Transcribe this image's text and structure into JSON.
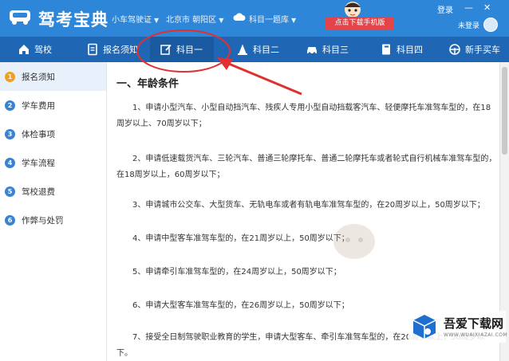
{
  "header": {
    "brand": "驾考宝典",
    "car_type": "小车驾驶证",
    "region": "北京市 朝阳区",
    "exam_select": "科目一题库",
    "promo": "点击下载手机版",
    "login": "登录",
    "user_name": "未登录",
    "win_min": "—",
    "win_close": "✕"
  },
  "nav": {
    "items": [
      {
        "label": "驾校",
        "icon": "home-icon"
      },
      {
        "label": "报名须知",
        "icon": "document-icon"
      },
      {
        "label": "科目一",
        "icon": "edit-icon"
      },
      {
        "label": "科目二",
        "icon": "cone-icon"
      },
      {
        "label": "科目三",
        "icon": "car-icon"
      },
      {
        "label": "科目四",
        "icon": "book-icon"
      },
      {
        "label": "新手买车",
        "icon": "steering-wheel-icon"
      }
    ]
  },
  "sidebar": {
    "items": [
      {
        "num": "1",
        "label": "报名须知"
      },
      {
        "num": "2",
        "label": "学车费用"
      },
      {
        "num": "3",
        "label": "体检事项"
      },
      {
        "num": "4",
        "label": "学车流程"
      },
      {
        "num": "5",
        "label": "驾校退费"
      },
      {
        "num": "6",
        "label": "作弊与处罚"
      }
    ]
  },
  "content": {
    "title": "一、年龄条件",
    "paragraphs": [
      "1、申请小型汽车、小型自动挡汽车、残疾人专用小型自动挡载客汽车、轻便摩托车准驾车型的，在18周岁以上、70周岁以下；",
      "2、申请低速载货汽车、三轮汽车、普通三轮摩托车、普通二轮摩托车或者轮式自行机械车准驾车型的，在18周岁以上，60周岁以下；",
      "3、申请城市公交车、大型货车、无轨电车或者有轨电车准驾车型的，在20周岁以上，50周岁以下；",
      "4、申请中型客车准驾车型的，在21周岁以上，50周岁以下；",
      "5、申请牵引车准驾车型的，在24周岁以上，50周岁以下；",
      "6、申请大型客车准驾车型的，在26周岁以上，50周岁以下；",
      "7、接受全日制驾驶职业教育的学生，申请大型客车、牵引车准驾车型的，在20周岁以上，50周岁以下。"
    ]
  },
  "watermark": {
    "text": "吾爱下载网",
    "sub": "WWW.WUAIXIAZAI.COM"
  },
  "colors": {
    "header_bg": "#2e86d9",
    "nav_bg": "#1f67b5",
    "accent_orange": "#f0a020",
    "promo_red": "#e5434a",
    "annotation_red": "#e03030"
  }
}
